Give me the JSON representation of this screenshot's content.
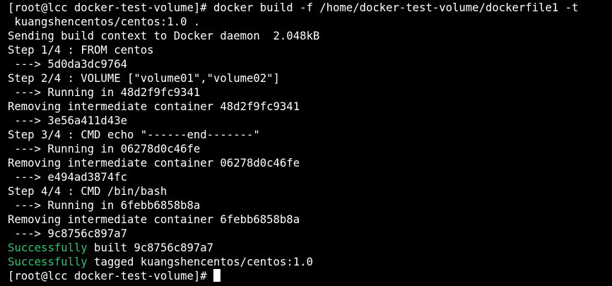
{
  "terminal": {
    "colors": {
      "background": "#000000",
      "text": "#ffffff",
      "success": "#29c36f"
    },
    "lines": [
      "[root@lcc docker-test-volume]# docker build -f /home/docker-test-volume/dockerfile1 -t",
      " kuangshencentos/centos:1.0 .",
      "Sending build context to Docker daemon  2.048kB",
      "Step 1/4 : FROM centos",
      " ---> 5d0da3dc9764",
      "Step 2/4 : VOLUME [\"volume01\",\"volume02\"]",
      " ---> Running in 48d2f9fc9341",
      "Removing intermediate container 48d2f9fc9341",
      " ---> 3e56a411d43e",
      "Step 3/4 : CMD echo \"------end-------\"",
      " ---> Running in 06278d0c46fe",
      "Removing intermediate container 06278d0c46fe",
      " ---> e494ad3874fc",
      "Step 4/4 : CMD /bin/bash",
      " ---> Running in 6febb6858b8a",
      "Removing intermediate container 6febb6858b8a",
      " ---> 9c8756c897a7"
    ],
    "success_built": {
      "keyword": "Successfully",
      "rest": " built 9c8756c897a7"
    },
    "success_tagged": {
      "keyword": "Successfully",
      "rest": " tagged kuangshencentos/centos:1.0"
    },
    "prompt": "[root@lcc docker-test-volume]# "
  }
}
